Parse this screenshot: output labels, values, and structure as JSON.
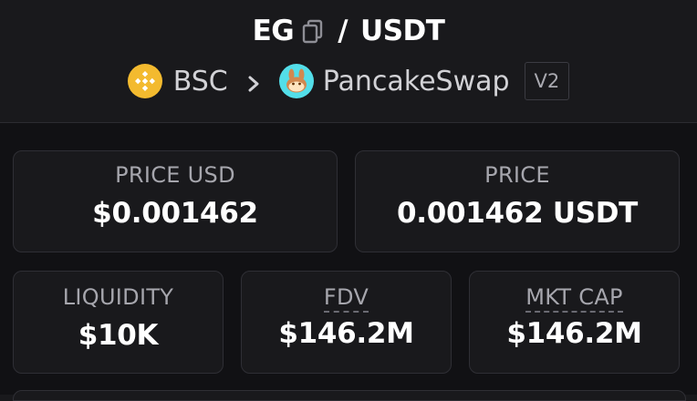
{
  "header": {
    "base_token": "EG",
    "separator": "/",
    "quote_token": "USDT",
    "chain": "BSC",
    "dex": "PancakeSwap",
    "version_badge": "V2"
  },
  "stats": {
    "price_usd": {
      "label": "PRICE USD",
      "value": "$0.001462"
    },
    "price": {
      "label": "PRICE",
      "value": "0.001462 USDT"
    },
    "liquidity": {
      "label": "LIQUIDITY",
      "value": "$10K"
    },
    "fdv": {
      "label": "FDV",
      "value": "$146.2M"
    },
    "mkt_cap": {
      "label": "MKT CAP",
      "value": "$146.2M"
    }
  },
  "colors": {
    "background": "#19191c",
    "panel": "#111114",
    "card_border": "#2f2f35",
    "bsc_yellow": "#f3ba2f",
    "pancake_teal": "#53dee9"
  },
  "icons": {
    "copy": "copy-icon",
    "chain": "bsc-logo-icon",
    "arrow": "chevron-right-icon",
    "dex": "pancakeswap-logo-icon"
  }
}
